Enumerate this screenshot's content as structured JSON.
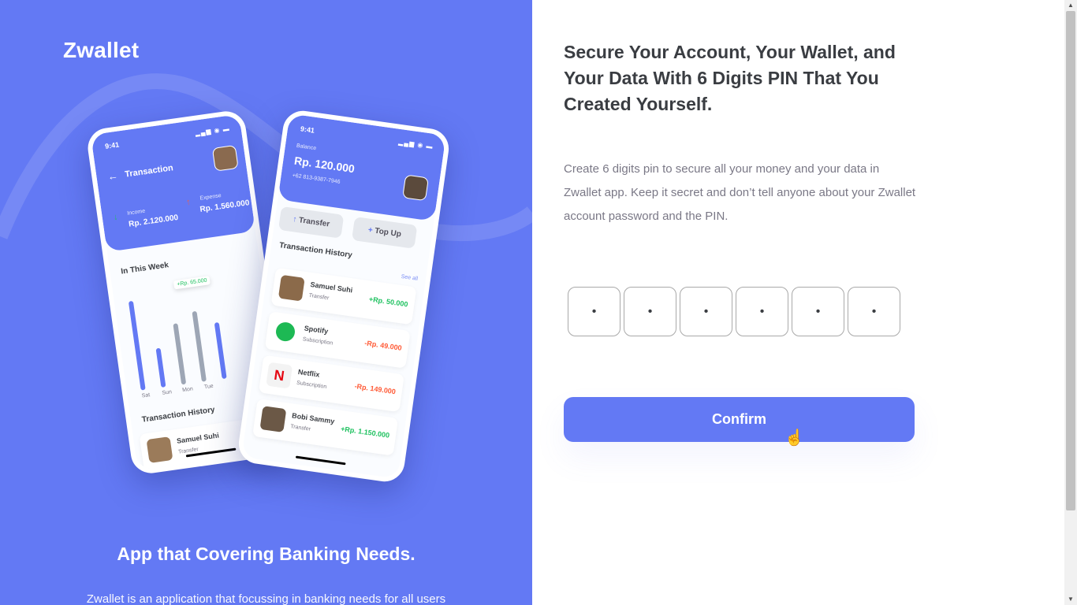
{
  "brand": {
    "name": "Zwallet"
  },
  "left": {
    "tagline": "App that Covering Banking Needs.",
    "description": "Zwallet is an application that focussing in banking needs for all users"
  },
  "phone1": {
    "time": "9:41",
    "title": "Transaction",
    "income_label": "Income",
    "income_value": "Rp. 2.120.000",
    "expense_label": "Expense",
    "expense_value": "Rp. 1.560.000",
    "week_title": "In This Week",
    "tooltip": "+Rp. 65.000",
    "days": [
      "Sat",
      "Sun",
      "Mon",
      "Tue"
    ],
    "bar_levels": [
      0.95,
      0.42,
      0.65,
      0.75,
      0.6
    ],
    "history_title": "Transaction History",
    "first_tx_name": "Samuel Suhi",
    "first_tx_type": "Transfer"
  },
  "phone2": {
    "time": "9:41",
    "balance_label": "Balance",
    "balance_value": "Rp. 120.000",
    "phone": "+62 813-9387-7946",
    "transfer_label": "Transfer",
    "topup_label": "Top Up",
    "history_title": "Transaction History",
    "see_all": "See all",
    "transactions": [
      {
        "name": "Samuel Suhi",
        "type": "Transfer",
        "amount": "+Rp. 50.000",
        "positive": true
      },
      {
        "name": "Spotify",
        "type": "Subscription",
        "amount": "-Rp. 49.000",
        "positive": false
      },
      {
        "name": "Netflix",
        "type": "Subscription",
        "amount": "-Rp. 149.000",
        "positive": false
      },
      {
        "name": "Bobi Sammy",
        "type": "Transfer",
        "amount": "+Rp. 1.150.000",
        "positive": true
      }
    ]
  },
  "right": {
    "heading": "Secure Your Account, Your Wallet, and Your Data With 6 Digits PIN That You Created Yourself.",
    "subtext": "Create 6 digits pin to secure all your money and your data in Zwallet app. Keep it secret and don’t tell anyone about your Zwallet account password and the PIN.",
    "pin_digits": [
      "•",
      "•",
      "•",
      "•",
      "•",
      "•"
    ],
    "confirm_label": "Confirm"
  },
  "colors": {
    "primary": "#6379F4",
    "heading": "#3A3D42",
    "muted": "#7A7886",
    "positive": "#1EC15F",
    "negative": "#FF5B37"
  }
}
